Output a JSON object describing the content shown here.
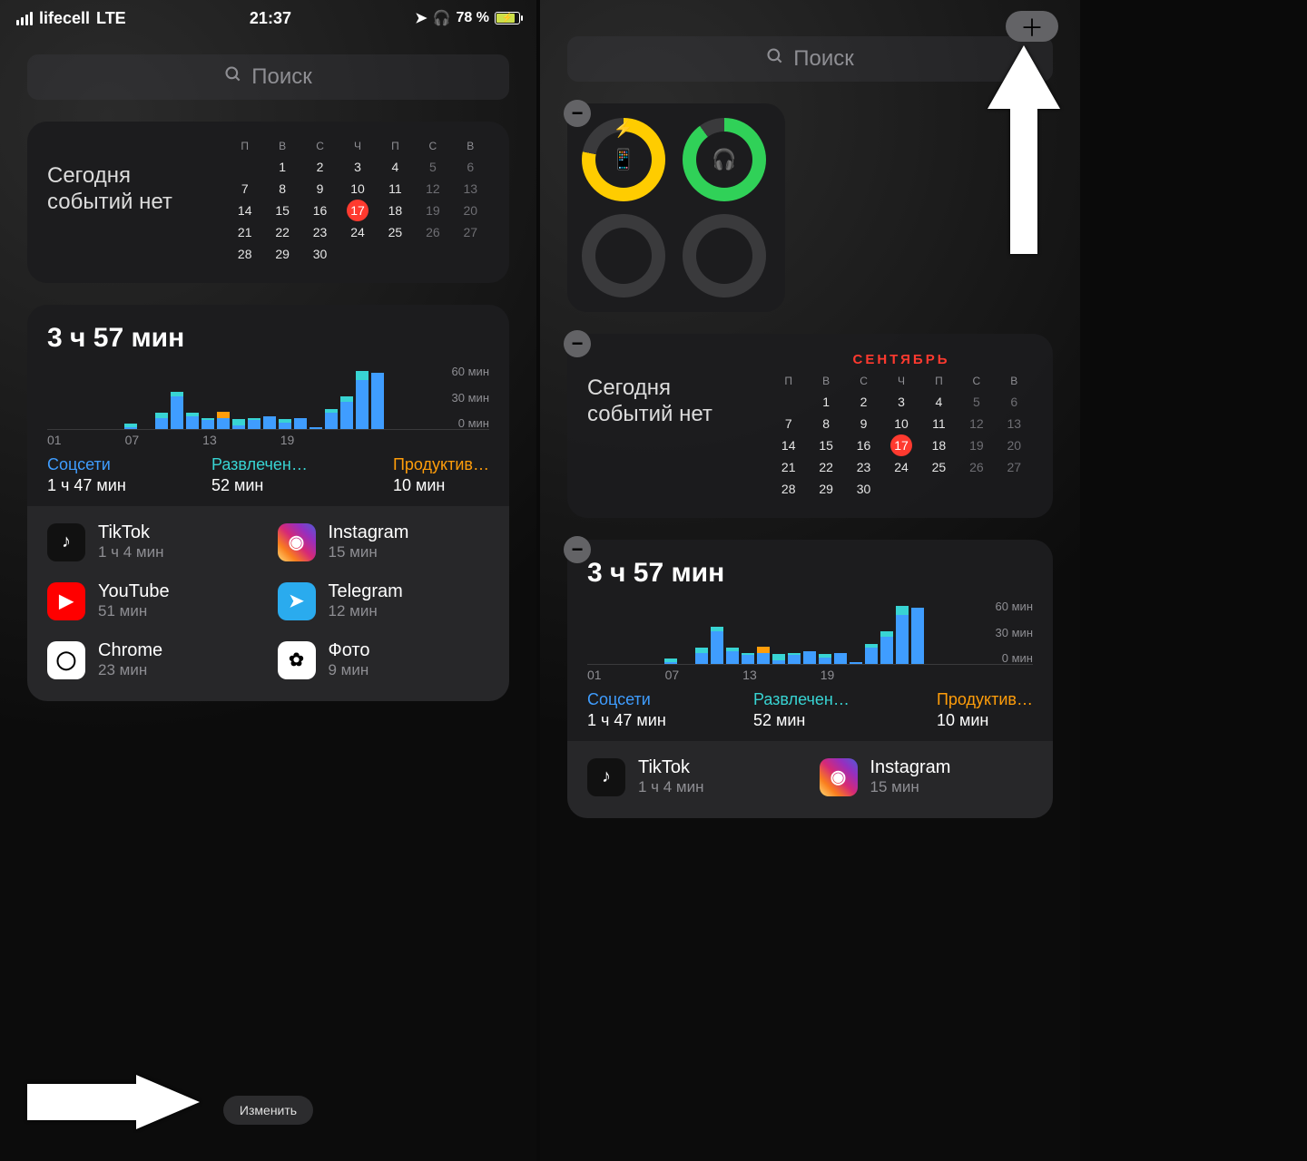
{
  "status": {
    "carrier": "lifecell",
    "network": "LTE",
    "time": "21:37",
    "battery_pct": "78 %"
  },
  "search": {
    "placeholder": "Поиск"
  },
  "calendar": {
    "no_events": "Сегодня событий нет",
    "month": "СЕНТЯБРЬ",
    "dow": [
      "П",
      "В",
      "С",
      "Ч",
      "П",
      "С",
      "В"
    ],
    "today": 17,
    "weeks": [
      [
        "",
        "1",
        "2",
        "3",
        "4",
        "5",
        "6"
      ],
      [
        "7",
        "8",
        "9",
        "10",
        "11",
        "12",
        "13"
      ],
      [
        "14",
        "15",
        "16",
        "17",
        "18",
        "19",
        "20"
      ],
      [
        "21",
        "22",
        "23",
        "24",
        "25",
        "26",
        "27"
      ],
      [
        "28",
        "29",
        "30",
        "",
        "",
        "",
        ""
      ]
    ],
    "weekend_cols": [
      5,
      6
    ]
  },
  "screentime": {
    "total": "3 ч 57 мин",
    "ylabels": [
      "60 мин",
      "30 мин",
      "0 мин"
    ],
    "xlabels": [
      "01",
      "07",
      "13",
      "19"
    ],
    "categories": [
      {
        "label": "Соцсети",
        "time": "1 ч 47 мин"
      },
      {
        "label": "Развлечен…",
        "time": "52 мин"
      },
      {
        "label": "Продуктив…",
        "time": "10 мин"
      }
    ],
    "apps": [
      {
        "name": "TikTok",
        "time": "1 ч 4 мин",
        "bg": "#111",
        "fg": "#fff",
        "glyph": "♪"
      },
      {
        "name": "Instagram",
        "time": "15 мин",
        "bg": "linear-gradient(45deg,#feda75,#fa7e1e,#d62976,#962fbf,#4f5bd5)",
        "fg": "#fff",
        "glyph": "◉"
      },
      {
        "name": "YouTube",
        "time": "51 мин",
        "bg": "#ff0000",
        "fg": "#fff",
        "glyph": "▶"
      },
      {
        "name": "Telegram",
        "time": "12 мин",
        "bg": "#2aabee",
        "fg": "#fff",
        "glyph": "➤"
      },
      {
        "name": "Chrome",
        "time": "23 мин",
        "bg": "#fff",
        "fg": "#000",
        "glyph": "◯"
      },
      {
        "name": "Фото",
        "time": "9 мин",
        "bg": "#fff",
        "fg": "#000",
        "glyph": "✿"
      }
    ]
  },
  "edit_label": "Изменить",
  "battery_widget": {
    "rings": [
      {
        "percent": 78,
        "color": "#ffcc00",
        "glyph": "📱",
        "charging": true
      },
      {
        "percent": 90,
        "color": "#30d158",
        "glyph": "🎧",
        "charging": false
      },
      {
        "percent": 0,
        "color": "#3a3a3c",
        "glyph": "",
        "charging": false
      },
      {
        "percent": 0,
        "color": "#3a3a3c",
        "glyph": "",
        "charging": false
      }
    ]
  },
  "chart_data": {
    "type": "bar",
    "title": "3 ч 57 мин",
    "ylabel": "мин",
    "ylim": [
      0,
      60
    ],
    "x": [
      1,
      2,
      3,
      4,
      5,
      6,
      7,
      8,
      9,
      10,
      11,
      12,
      13,
      14,
      15,
      16,
      17,
      18,
      19,
      20,
      21,
      22,
      23,
      24
    ],
    "series": [
      {
        "name": "Соцсети",
        "color": "#3f9dff",
        "values": [
          0,
          0,
          0,
          0,
          0,
          2,
          0,
          10,
          30,
          12,
          8,
          10,
          3,
          8,
          12,
          6,
          10,
          2,
          15,
          25,
          45,
          52,
          0,
          0
        ]
      },
      {
        "name": "Развлечения",
        "color": "#38d4d3",
        "values": [
          0,
          0,
          0,
          0,
          0,
          3,
          0,
          5,
          4,
          3,
          2,
          0,
          6,
          2,
          0,
          3,
          0,
          0,
          3,
          5,
          8,
          0,
          0,
          0
        ]
      },
      {
        "name": "Продуктивность",
        "color": "#ff9d0a",
        "values": [
          0,
          0,
          0,
          0,
          0,
          0,
          0,
          0,
          0,
          0,
          0,
          6,
          0,
          0,
          0,
          0,
          0,
          0,
          0,
          0,
          0,
          0,
          0,
          0
        ]
      }
    ]
  }
}
